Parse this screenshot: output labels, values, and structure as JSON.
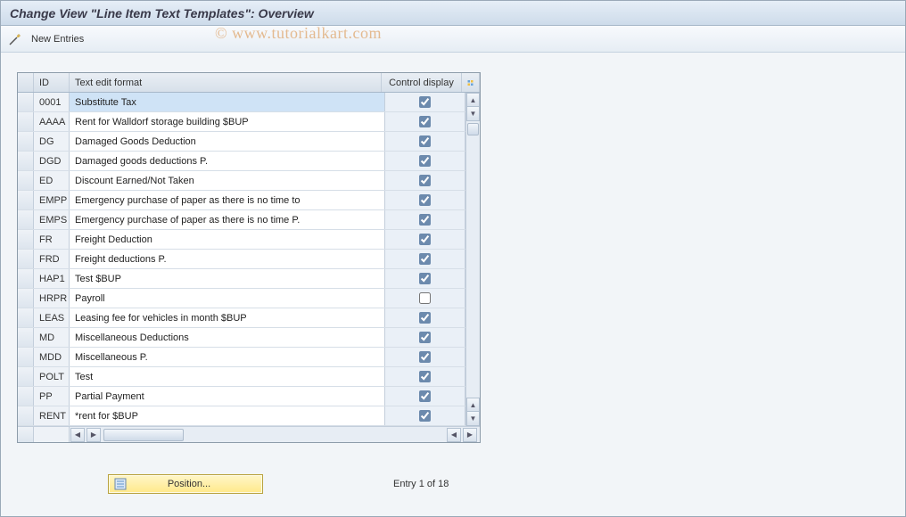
{
  "title": "Change View \"Line Item Text Templates\": Overview",
  "toolbar": {
    "new_entries": "New Entries"
  },
  "watermark": "© www.tutorialkart.com",
  "columns": {
    "sel": "",
    "id": "ID",
    "text": "Text edit format",
    "ctrl": "Control display"
  },
  "rows": [
    {
      "id": "0001",
      "text": "Substitute Tax",
      "ctrl": true,
      "selected": true
    },
    {
      "id": "AAAA",
      "text": "Rent for Walldorf storage building $BUP",
      "ctrl": true
    },
    {
      "id": "DG",
      "text": "Damaged Goods Deduction",
      "ctrl": true
    },
    {
      "id": "DGD",
      "text": "Damaged goods deductions P.",
      "ctrl": true
    },
    {
      "id": "ED",
      "text": "Discount Earned/Not Taken",
      "ctrl": true
    },
    {
      "id": "EMPP",
      "text": "Emergency purchase of paper as there is no time to",
      "ctrl": true
    },
    {
      "id": "EMPS",
      "text": "Emergency purchase of paper as there is no time P.",
      "ctrl": true
    },
    {
      "id": "FR",
      "text": "Freight Deduction",
      "ctrl": true
    },
    {
      "id": "FRD",
      "text": "Freight deductions P.",
      "ctrl": true
    },
    {
      "id": "HAP1",
      "text": "Test $BUP",
      "ctrl": true
    },
    {
      "id": "HRPR",
      "text": "Payroll",
      "ctrl": false
    },
    {
      "id": "LEAS",
      "text": "Leasing fee for vehicles in month $BUP",
      "ctrl": true
    },
    {
      "id": "MD",
      "text": "Miscellaneous Deductions",
      "ctrl": true
    },
    {
      "id": "MDD",
      "text": "Miscellaneous P.",
      "ctrl": true
    },
    {
      "id": "POLT",
      "text": "Test",
      "ctrl": true
    },
    {
      "id": "PP",
      "text": "Partial Payment",
      "ctrl": true
    },
    {
      "id": "RENT",
      "text": "*rent for $BUP",
      "ctrl": true
    }
  ],
  "footer": {
    "position_label": "Position...",
    "entry_text": "Entry 1 of 18"
  }
}
